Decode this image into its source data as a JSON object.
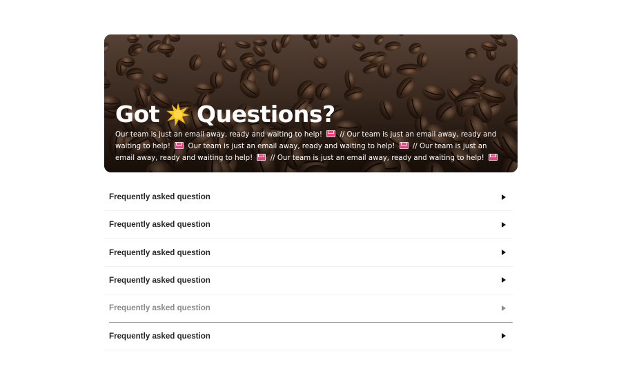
{
  "hero": {
    "title_before": "Got",
    "title_after": "Questions?",
    "title_icon": "sparkle-sun-icon",
    "text_segments": [
      "Our team is just an email away, ready and waiting to help!",
      "// Our team is just an email away, ready and waiting to help!",
      "Our team is just an email away, ready and waiting to help!",
      "// Our team is just an email away, ready and waiting to help!",
      "// Our team is just an email away, ready and waiting to help!"
    ],
    "text_icon": "love-letter-icon",
    "background": "coffee-beans-photo"
  },
  "faq": {
    "items": [
      {
        "label": "Frequently asked question",
        "state": "normal"
      },
      {
        "label": "Frequently asked question",
        "state": "normal"
      },
      {
        "label": "Frequently asked question",
        "state": "normal"
      },
      {
        "label": "Frequently asked question",
        "state": "normal"
      },
      {
        "label": "Frequently asked question",
        "state": "hover"
      },
      {
        "label": "Frequently asked question",
        "state": "normal"
      }
    ],
    "toggle_icon": "caret-right-icon"
  },
  "colors": {
    "heading_text": "#262626",
    "dim_text": "#8a8a8a",
    "hero_text": "#ffffff",
    "mail_icon": "#e8457d"
  }
}
